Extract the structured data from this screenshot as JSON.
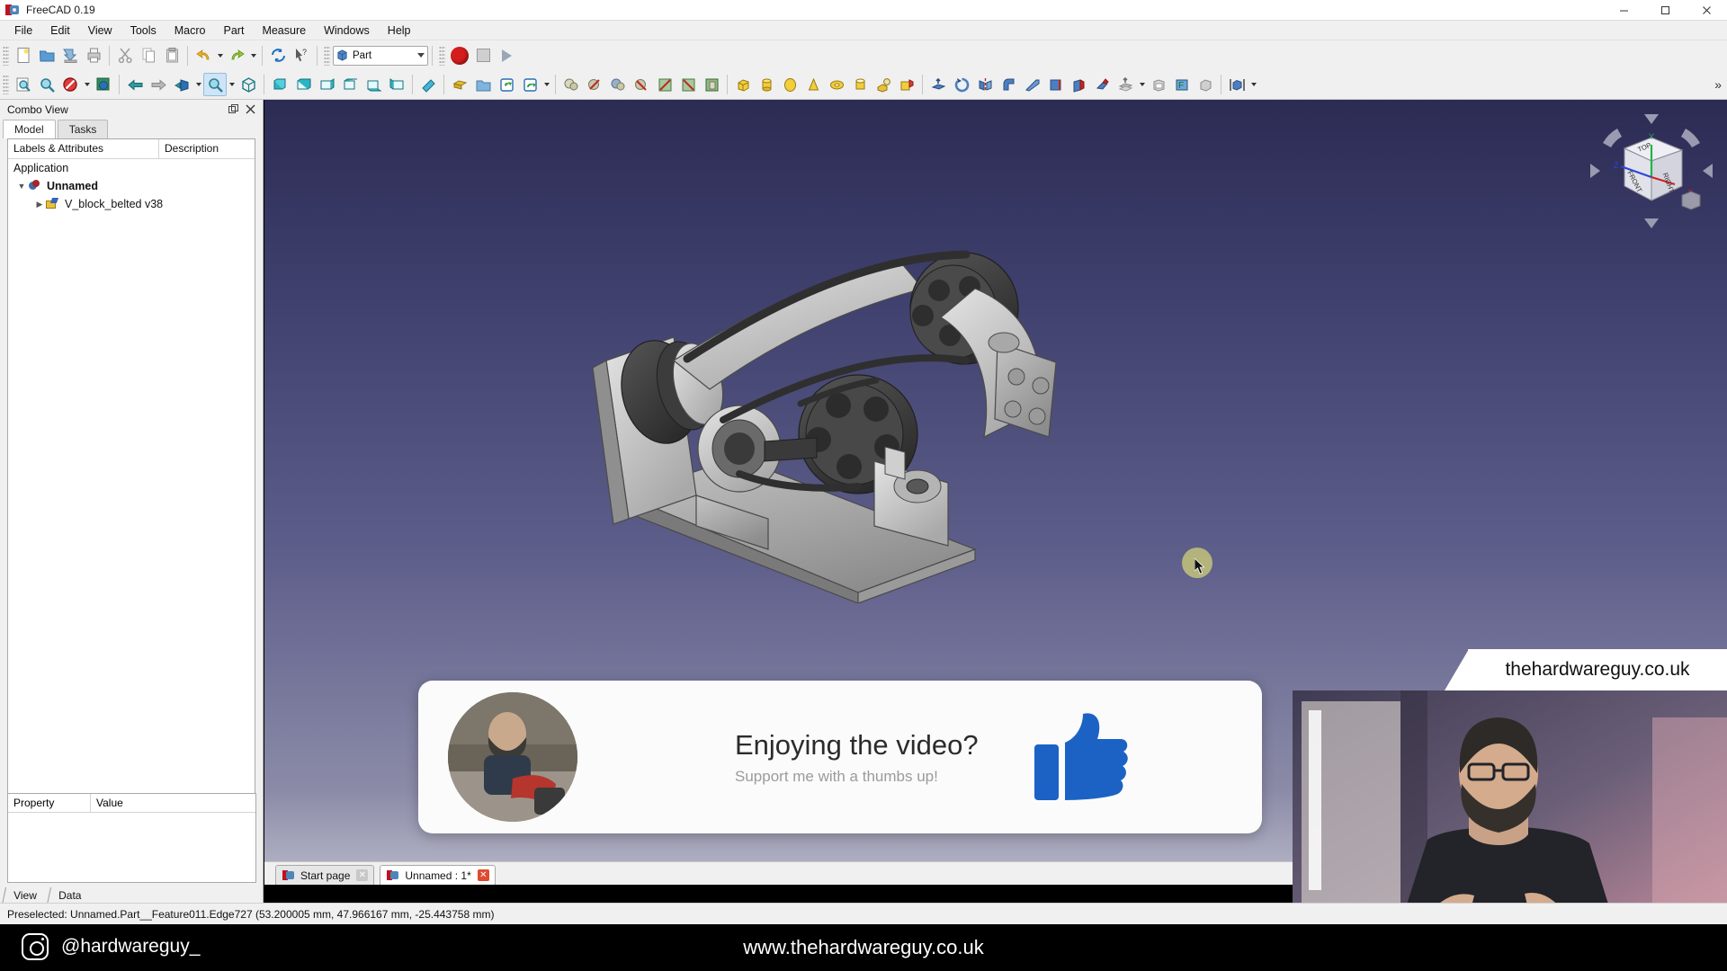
{
  "window": {
    "title": "FreeCAD 0.19",
    "app_icon": "freecad-icon",
    "minimize": "minimize-button",
    "maximize": "maximize-button",
    "close": "close-button"
  },
  "menubar": {
    "items": [
      "File",
      "Edit",
      "View",
      "Tools",
      "Macro",
      "Part",
      "Measure",
      "Windows",
      "Help"
    ]
  },
  "toolbar_top": {
    "workbench_selected": "Part",
    "buttons": [
      "new-document-icon",
      "open-document-icon",
      "save-document-icon",
      "print-icon",
      "cut-icon",
      "copy-icon",
      "paste-icon",
      "undo-icon",
      "redo-icon",
      "refresh-icon",
      "whats-this-icon"
    ],
    "macro_record": "record-macro-button",
    "macro_stop": "stop-macro-button",
    "macro_play": "execute-macro-button"
  },
  "toolbar_view": {
    "buttons": [
      "fit-all-icon",
      "fit-selection-icon",
      "draw-style-icon",
      "box-zoom-icon",
      "back-view-nav-icon",
      "forward-view-nav-icon",
      "axonometric-icon",
      "zoom-selector-icon",
      "isometric-view-icon",
      "front-view-icon",
      "top-view-icon",
      "right-view-icon",
      "rear-view-icon",
      "bottom-view-icon",
      "left-view-icon",
      "measure-icon",
      "extrude-icon",
      "part-folder-icon",
      "revolve-icon",
      "mirror-icon",
      "boolean-icon",
      "cut-icon",
      "union-icon",
      "intersection-icon",
      "section-icon",
      "box-primitive-icon",
      "cylinder-primitive-icon",
      "sphere-primitive-icon",
      "cone-primitive-icon",
      "torus-primitive-icon",
      "tube-primitive-icon",
      "shape-builder-icon",
      "primitives-icon",
      "extrude-face-icon",
      "revolution-icon",
      "mirroring-icon",
      "fillet-icon",
      "chamfer-icon",
      "ruled-surface-icon",
      "loft-icon",
      "sweep-icon",
      "offset-icon",
      "thickness-icon",
      "projection-icon",
      "bounding-box-icon",
      "compound-icon"
    ]
  },
  "combo_view": {
    "title": "Combo View",
    "float_button": "float-panel-button",
    "close_button": "close-panel-button",
    "tabs": [
      {
        "label": "Model",
        "selected": true
      },
      {
        "label": "Tasks",
        "selected": false
      }
    ],
    "tree_headers": [
      "Labels & Attributes",
      "Description"
    ],
    "tree": [
      {
        "label": "Application",
        "level": 0,
        "icon": "none",
        "expander": ""
      },
      {
        "label": "Unnamed",
        "level": 1,
        "icon": "document-icon",
        "expander": "expanded",
        "bold": true
      },
      {
        "label": "V_block_belted v38",
        "level": 2,
        "icon": "part-icon",
        "expander": "collapsed",
        "bold": false
      }
    ],
    "property_headers": [
      "Property",
      "Value"
    ],
    "bottom_tabs": [
      {
        "label": "View",
        "selected": false
      },
      {
        "label": "Data",
        "selected": true
      }
    ]
  },
  "viewport": {
    "nav_cube": {
      "faces": [
        "TOP",
        "FRONT",
        "RIGHT"
      ],
      "axis_labels": [
        "X",
        "Y",
        "Z"
      ],
      "home_button": "home-view-icon"
    },
    "model_name": "V_block_belted v38",
    "cursor": "mouse-cursor"
  },
  "document_tabs": [
    {
      "label": "Start page",
      "selected": false,
      "close": "close-tab-button"
    },
    {
      "label": "Unnamed : 1*",
      "selected": true,
      "close": "close-tab-button"
    }
  ],
  "statusbar": {
    "text": "Preselected: Unnamed.Part__Feature011.Edge727 (53.200005 mm, 47.966167 mm, -25.443758 mm)"
  },
  "overlay_card": {
    "title": "Enjoying the video?",
    "subtitle": "Support me with a thumbs up!",
    "thumb_icon": "thumbs-up-icon",
    "avatar": "presenter-avatar",
    "thumb_color": "#1b62c4"
  },
  "pip": {
    "label": "thehardwareguy.co.uk"
  },
  "banner": {
    "instagram_icon": "instagram-icon",
    "handle": "@hardwareguy_",
    "website": "www.thehardwareguy.co.uk"
  },
  "colors": {
    "chrome": "#f0f0f0",
    "viewport_top": "#2b2b54",
    "viewport_bottom": "#b9b9c9",
    "accent_red": "#c1121f",
    "thumb_blue": "#1b62c4"
  }
}
